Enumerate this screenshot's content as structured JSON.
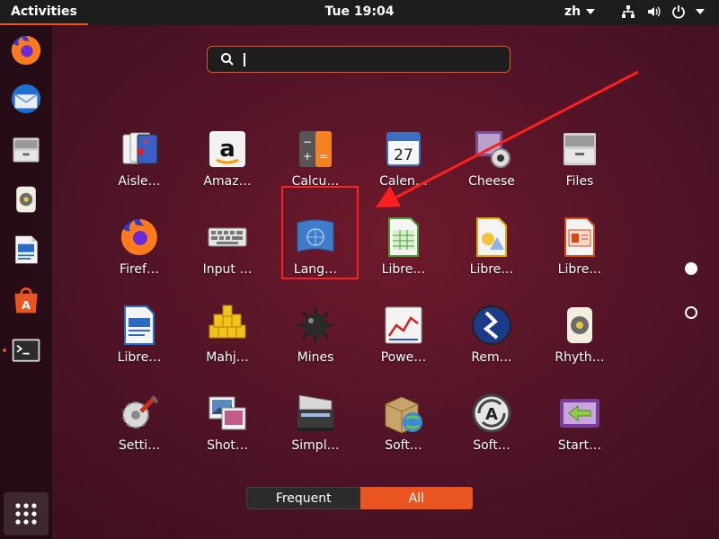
{
  "topbar": {
    "activities_label": "Activities",
    "clock": "Tue 19:04",
    "language": "zh",
    "icons": [
      "network-icon",
      "volume-icon",
      "power-icon"
    ]
  },
  "dock": {
    "items": [
      "firefox-icon",
      "thunderbird-icon",
      "files-icon",
      "rhythmbox-icon",
      "libreoffice-writer-icon",
      "software-icon",
      "terminal-icon"
    ],
    "running": "terminal-icon",
    "show_apps_icon": "grid-icon"
  },
  "search": {
    "value": "",
    "icon": "search-icon"
  },
  "apps": [
    {
      "label": "Aisle…",
      "icon": "cards-icon"
    },
    {
      "label": "Amaz…",
      "icon": "amazon-icon"
    },
    {
      "label": "Calcu…",
      "icon": "calculator-icon"
    },
    {
      "label": "Calen…",
      "icon": "calendar-icon",
      "day": "27"
    },
    {
      "label": "Cheese",
      "icon": "webcam-icon"
    },
    {
      "label": "Files",
      "icon": "files-icon"
    },
    {
      "label": "Firef…",
      "icon": "firefox-icon"
    },
    {
      "label": "Input …",
      "icon": "keyboard-icon"
    },
    {
      "label": "Lang…",
      "icon": "language-flag-icon"
    },
    {
      "label": "Libre…",
      "icon": "libreoffice-calc-icon"
    },
    {
      "label": "Libre…",
      "icon": "libreoffice-draw-icon"
    },
    {
      "label": "Libre…",
      "icon": "libreoffice-impress-icon"
    },
    {
      "label": "Libre…",
      "icon": "libreoffice-writer-icon"
    },
    {
      "label": "Mahj…",
      "icon": "mahjongg-icon"
    },
    {
      "label": "Mines",
      "icon": "mine-icon"
    },
    {
      "label": "Powe…",
      "icon": "power-statistics-icon"
    },
    {
      "label": "Rem…",
      "icon": "remmina-icon"
    },
    {
      "label": "Rhyth…",
      "icon": "rhythmbox-icon"
    },
    {
      "label": "Setti…",
      "icon": "settings-icon"
    },
    {
      "label": "Shot…",
      "icon": "shotwell-icon"
    },
    {
      "label": "Simpl…",
      "icon": "scanner-icon"
    },
    {
      "label": "Soft…",
      "icon": "software-properties-icon"
    },
    {
      "label": "Soft…",
      "icon": "software-updater-icon"
    },
    {
      "label": "Start…",
      "icon": "startup-disk-icon"
    }
  ],
  "pages": {
    "count": 2,
    "current": 1
  },
  "view_switch": {
    "frequent": "Frequent",
    "all": "All",
    "active": "all"
  },
  "colors": {
    "accent": "#e95420",
    "highlight": "#ff1f1f"
  }
}
